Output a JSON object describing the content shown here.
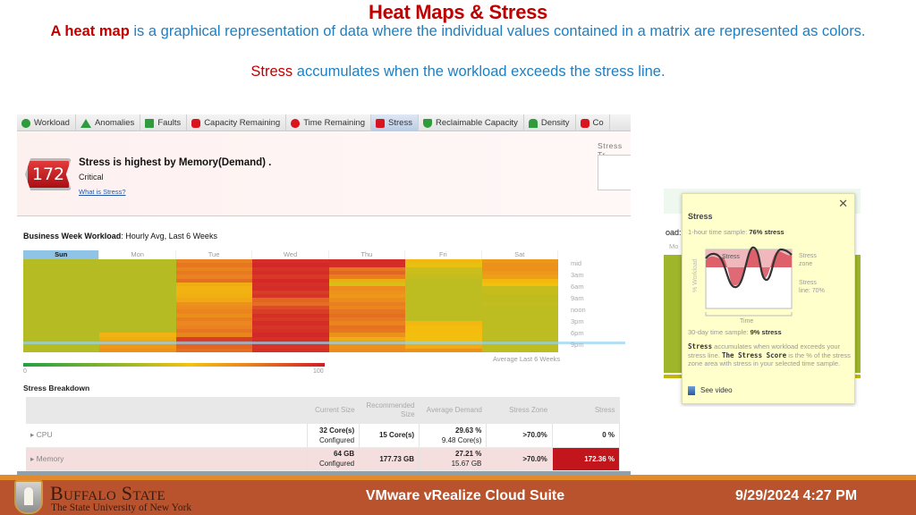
{
  "slide": {
    "title": "Heat Maps & Stress",
    "intro_term": "A heat map",
    "intro_text": " is a graphical representation of data where the individual values contained in a matrix are represented as colors.",
    "stress_term": "Stress",
    "stress_text": " accumulates when the workload exceeds the stress line."
  },
  "app": {
    "tabs": [
      {
        "label": "Workload",
        "icon": "workload-icon",
        "active": false
      },
      {
        "label": "Anomalies",
        "icon": "anomalies-icon",
        "active": false
      },
      {
        "label": "Faults",
        "icon": "faults-icon",
        "active": false
      },
      {
        "label": "Capacity Remaining",
        "icon": "capacity-remaining-icon",
        "active": false
      },
      {
        "label": "Time Remaining",
        "icon": "time-remaining-icon",
        "active": false
      },
      {
        "label": "Stress",
        "icon": "stress-icon",
        "active": true
      },
      {
        "label": "Reclaimable Capacity",
        "icon": "reclaimable-capacity-icon",
        "active": false
      },
      {
        "label": "Density",
        "icon": "density-icon",
        "active": false
      },
      {
        "label": "Co",
        "icon": "compliance-icon",
        "active": false
      }
    ],
    "summary": {
      "score": "172",
      "headline": "Stress is highest by Memory(Demand) .",
      "status": "Critical",
      "link": "What is Stress?",
      "trend_label": "Stress Tr"
    },
    "heatmap": {
      "title_bold": "Business Week Workload",
      "title_rest": ": Hourly Avg, Last 6 Weeks",
      "days": [
        "Sun",
        "Mon",
        "Tue",
        "Wed",
        "Thu",
        "Fri",
        "Sat"
      ],
      "selected_day": "Sun",
      "times": [
        "mid",
        "3am",
        "6am",
        "9am",
        "noon",
        "3pm",
        "6pm",
        "9pm"
      ],
      "selected_time": "9pm",
      "footer": "Average Last 6 Weeks",
      "scale_min": "0",
      "scale_max": "100",
      "values": [
        [
          40,
          40,
          40,
          40,
          40,
          40,
          40,
          40,
          40,
          40,
          40,
          40,
          40,
          40,
          40,
          40,
          40,
          40,
          40,
          40,
          40,
          40,
          40,
          40
        ],
        [
          40,
          40,
          40,
          40,
          40,
          40,
          40,
          40,
          40,
          40,
          40,
          40,
          40,
          40,
          40,
          40,
          40,
          40,
          40,
          60,
          62,
          65,
          68,
          70
        ],
        [
          75,
          78,
          74,
          77,
          75,
          80,
          62,
          60,
          60,
          61,
          63,
          70,
          72,
          74,
          71,
          76,
          73,
          75,
          78,
          74,
          92,
          90,
          82,
          80
        ],
        [
          95,
          97,
          94,
          96,
          93,
          97,
          95,
          96,
          92,
          94,
          82,
          80,
          88,
          92,
          95,
          93,
          96,
          94,
          95,
          97,
          95,
          96,
          94,
          95
        ],
        [
          96,
          96,
          78,
          82,
          76,
          62,
          48,
          72,
          70,
          68,
          72,
          76,
          74,
          78,
          80,
          77,
          74,
          79,
          78,
          70,
          62,
          66,
          70,
          72
        ],
        [
          58,
          52,
          45,
          45,
          44,
          42,
          42,
          42,
          42,
          42,
          42,
          42,
          42,
          42,
          42,
          42,
          58,
          57,
          57,
          56,
          56,
          55,
          62,
          70
        ],
        [
          68,
          70,
          70,
          68,
          66,
          58,
          56,
          44,
          44,
          43,
          42,
          44,
          42,
          42,
          42,
          42,
          42,
          42,
          42,
          42,
          42,
          42,
          42,
          42
        ]
      ]
    },
    "breakdown": {
      "title": "Stress Breakdown",
      "columns": [
        "",
        "Current Size",
        "Recommended Size",
        "Average Demand",
        "Stress Zone",
        "Stress"
      ],
      "rows": [
        {
          "name": "CPU",
          "current_main": "32 Core(s)",
          "current_sub": "Configured",
          "recommended": "15 Core(s)",
          "demand_main": "29.63 %",
          "demand_sub": "9.48 Core(s)",
          "zone": ">70.0%",
          "stress": "0 %",
          "critical": false
        },
        {
          "name": "Memory",
          "current_main": "64 GB",
          "current_sub": "Configured",
          "recommended": "177.73 GB",
          "demand_main": "27.21 %",
          "demand_sub": "15.67 GB",
          "zone": ">70.0%",
          "stress": "172.36 %",
          "critical": true
        }
      ]
    },
    "accent_critical": "#c2151c"
  },
  "tooltip": {
    "bg_label": "oad:",
    "bg_col": "Mo",
    "title": "Stress",
    "hour_label": "1-hour time sample: ",
    "hour_value": "76% stress",
    "chart_curve_label": "Stress",
    "zone_label": "Stress zone",
    "line_label": "Stress line: 70%",
    "y_axis": "% Workload",
    "x_axis": "Time",
    "day_label": "30-day time sample: ",
    "day_value": "9% stress",
    "desc_b1": "Stress",
    "desc_1": " accumulates when workload exceeds your stress line. ",
    "desc_b2": "The Stress Score",
    "desc_2": " is the % of the stress zone area with stress in your selected time sample.",
    "video": "See video",
    "close": "✕"
  },
  "footer": {
    "org_name": "Buffalo State",
    "org_sub": "The State University of New York",
    "center": "VMware vRealize Cloud Suite",
    "date": "9/29/2024 4:27 PM"
  }
}
